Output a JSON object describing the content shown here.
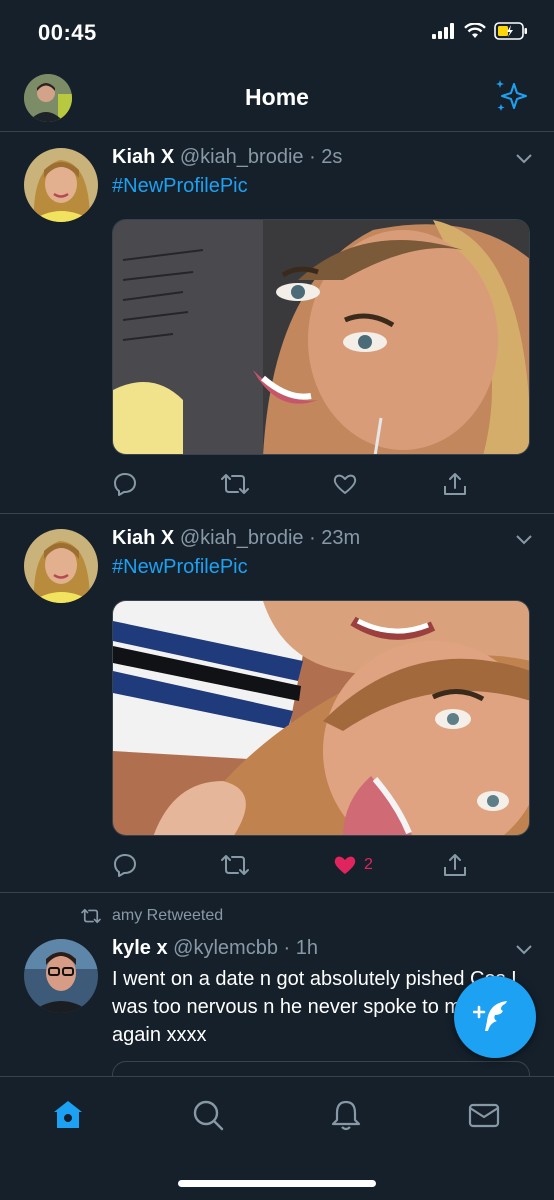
{
  "status_bar": {
    "time": "00:45"
  },
  "header": {
    "title": "Home",
    "avatar_icon": "user-avatar",
    "sparkle_icon": "sparkle-icon"
  },
  "tweets": [
    {
      "name": "Kiah X",
      "handle": "@kiah_brodie",
      "time": "· 2s",
      "text": "#NewProfilePic",
      "like_count": "",
      "liked": false
    },
    {
      "name": "Kiah X",
      "handle": "@kiah_brodie",
      "time": "· 23m",
      "text": "#NewProfilePic",
      "like_count": "2",
      "liked": true
    },
    {
      "retweeted_by": "amy Retweeted",
      "name": "kyle x",
      "handle": "@kylemcbb",
      "time": "· 1h",
      "text": "I went on a date n got absolutely pished Cos I was too nervous n he never spoke to me again xxxx"
    }
  ],
  "tabs": [
    {
      "name": "home",
      "icon": "home-icon",
      "active": true
    },
    {
      "name": "search",
      "icon": "search-icon",
      "active": false
    },
    {
      "name": "notifications",
      "icon": "bell-icon",
      "active": false
    },
    {
      "name": "messages",
      "icon": "mail-icon",
      "active": false
    }
  ],
  "colors": {
    "background": "#15202b",
    "accent": "#1da1f2",
    "muted": "#8899a6",
    "like": "#e0245e",
    "divider": "#38444d"
  }
}
